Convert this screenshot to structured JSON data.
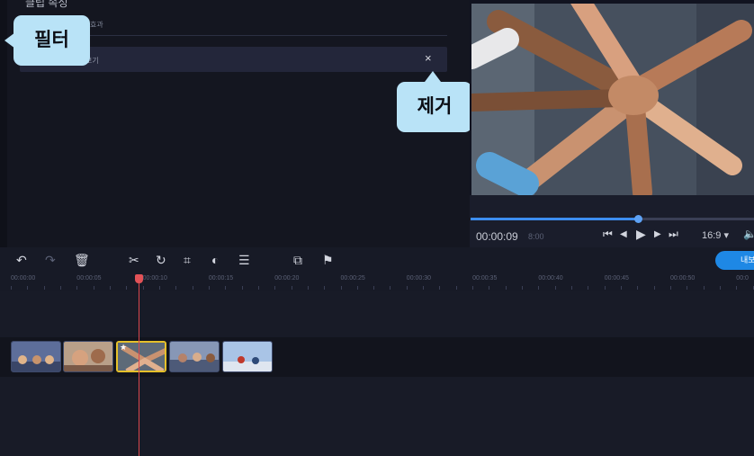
{
  "panel": {
    "title": "클립 속성",
    "effect_label": "효과",
    "filter_name": "보기",
    "remove_symbol": "×"
  },
  "callouts": {
    "filter": "필터",
    "remove": "제거"
  },
  "player": {
    "time_current": "00:00:09",
    "time_total": "8:00",
    "progress_fraction": 0.59,
    "aspect": "16:9 ▾",
    "buttons": {
      "skip_back": "⏮",
      "frame_back": "◀",
      "play": "▶",
      "frame_forward": "▶",
      "skip_forward": "⏭"
    },
    "volume_icon": "speaker-icon"
  },
  "toolbar": {
    "icons": [
      "undo-icon",
      "redo-icon",
      "delete-icon",
      "cut-icon",
      "rotate-icon",
      "crop-icon",
      "color-adjust-icon",
      "settings-icon",
      "overlay-icon",
      "flag-icon"
    ],
    "export_label": "내보"
  },
  "ruler": {
    "ticks": [
      "00:00:00",
      "00:00:05",
      "00:00:10",
      "00:00:15",
      "00:00:20",
      "00:00:25",
      "00:00:30",
      "00:00:35",
      "00:00:40",
      "00:00:45",
      "00:00:50",
      "00:0"
    ]
  },
  "timeline": {
    "playhead_time": "00:00:10",
    "clip_count": 5,
    "selected_clip": 3
  },
  "colors": {
    "accent": "#1e88e5",
    "callout": "#b9e3f7",
    "playhead": "#e25257",
    "selection": "#e5c02a"
  }
}
